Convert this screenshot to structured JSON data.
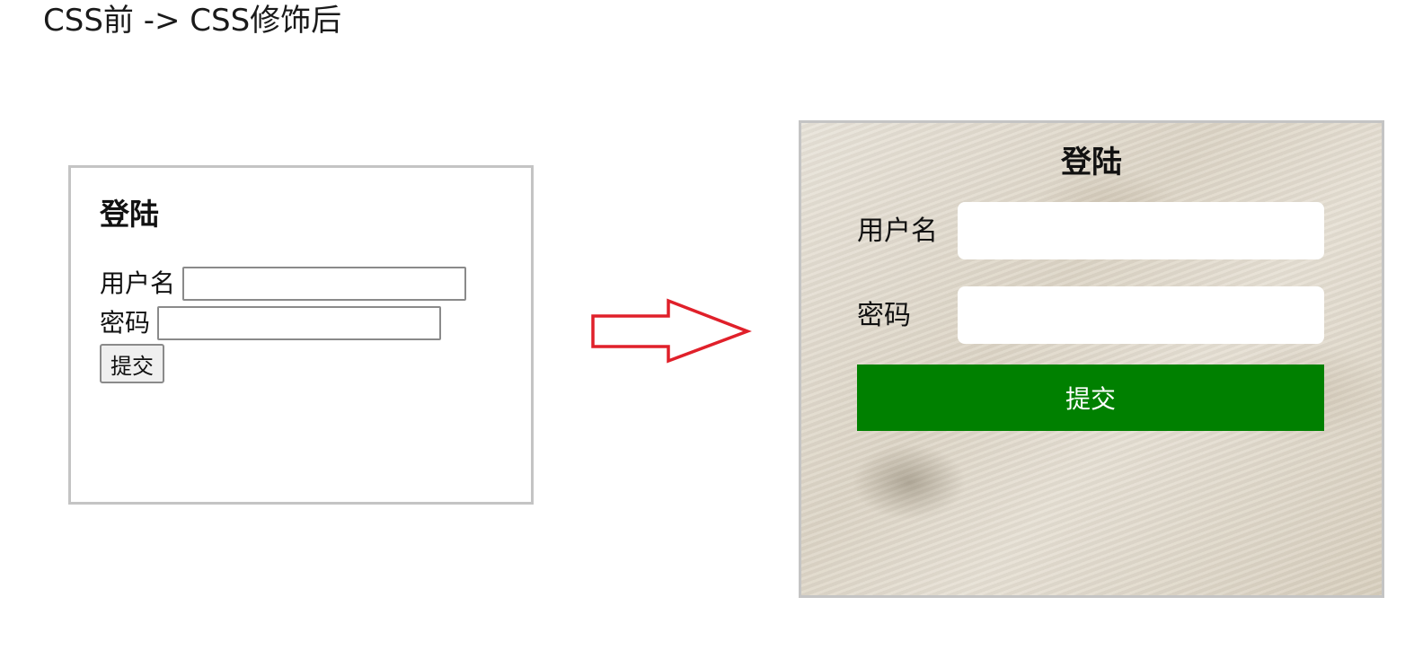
{
  "caption": "CSS前 -> CSS修饰后",
  "before": {
    "title": "登陆",
    "username_label": "用户名",
    "password_label": "密码",
    "submit_label": "提交",
    "username_value": "",
    "password_value": ""
  },
  "after": {
    "title": "登陆",
    "username_label": "用户名",
    "password_label": "密码",
    "submit_label": "提交",
    "username_value": "",
    "password_value": ""
  },
  "colors": {
    "arrow": "#e0202a",
    "submit_bg": "#008000",
    "border": "#c4c4c4"
  },
  "icons": {
    "arrow": "right-arrow-outline"
  }
}
